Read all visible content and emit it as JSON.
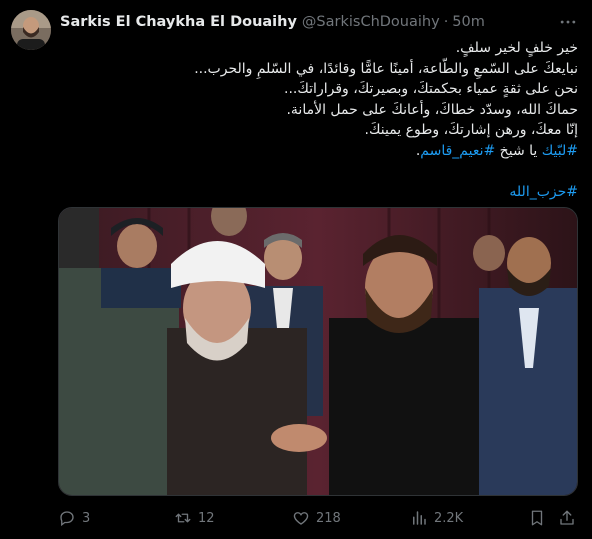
{
  "tweet": {
    "author_name": "Sarkis El Chaykha El Douaihy",
    "handle": "@SarkisChDouaihy",
    "separator": "·",
    "time": "50m",
    "lines": [
      {
        "text": "خير خلفٍ لخير سلفٍ.",
        "hashtag": "",
        "tail": ""
      },
      {
        "text": "نبايعكَ على السّمعِ والطّاعة، أمينًا عامًّا وقائدًا، في السّلمِ والحرب...",
        "hashtag": "",
        "tail": ""
      },
      {
        "text": "نحن على ثقةٍ عمياء بحكمتكَ، وبصيرتكَ، وقراراتكَ...",
        "hashtag": "",
        "tail": ""
      },
      {
        "text": "حماكَ الله، وسدّد خطاكَ، وأعانكَ على حمل الأمانة.",
        "hashtag": "",
        "tail": ""
      },
      {
        "text": "إنّا معكَ، ورهن إشارتكَ، وطوع يمينكَ.",
        "hashtag": "",
        "tail": ""
      },
      {
        "text": "",
        "hashtag": "#لبّيك",
        "tail": " يا شيخ "
      },
      {
        "text": "",
        "hashtag": "#نعيم_قاسم",
        "tail": "."
      }
    ],
    "footer_hashtag": "#حزب_الله",
    "stats": {
      "replies": "3",
      "reposts": "12",
      "likes": "218",
      "views": "2.2K"
    }
  },
  "icons": {
    "more": "more-icon",
    "reply": "reply-icon",
    "repost": "repost-icon",
    "like": "like-icon",
    "views": "views-icon",
    "bookmark": "bookmark-icon",
    "share": "share-icon"
  },
  "colors": {
    "background": "#000000",
    "text": "#e7e9ea",
    "muted": "#71767b",
    "link": "#1d9bf0"
  }
}
